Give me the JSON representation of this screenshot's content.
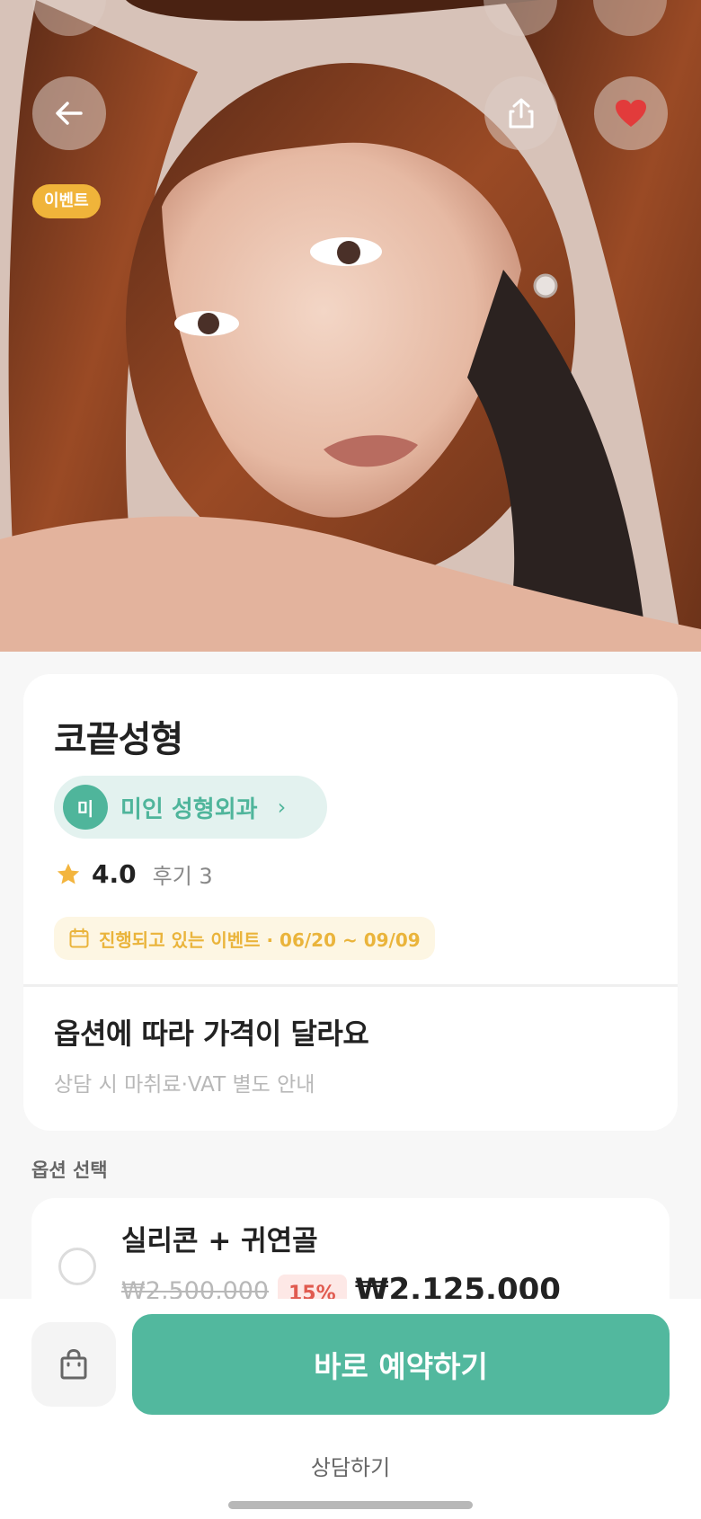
{
  "hero": {
    "badge": "이벤트",
    "back_icon": "arrow-left-icon",
    "share_icon": "share-icon",
    "like_icon": "heart-icon"
  },
  "product": {
    "title": "코끝성형",
    "clinic_initial": "미",
    "clinic_name": "미인 성형외과",
    "rating": "4.0",
    "review_label": "후기 3",
    "event_period": "진행되고 있는 이벤트 · 06/20 ~ 09/09",
    "price_title": "옵션에 따라 가격이 달라요",
    "price_sub": "상담 시 마취료·VAT 별도 안내"
  },
  "options": {
    "section_label": "옵션 선택",
    "items": [
      {
        "name": "실리콘 + 귀연골",
        "original_price": "₩2,500,000",
        "discount": "15%",
        "price": "₩2,125,000"
      }
    ]
  },
  "bottom": {
    "reserve_label": "바로 예약하기",
    "consult_label": "상담하기",
    "bag_icon": "shopping-bag-icon"
  },
  "colors": {
    "accent": "#52b89e",
    "event": "#f0b43a",
    "like": "#e23b3b",
    "discount": "#e05a4f"
  }
}
